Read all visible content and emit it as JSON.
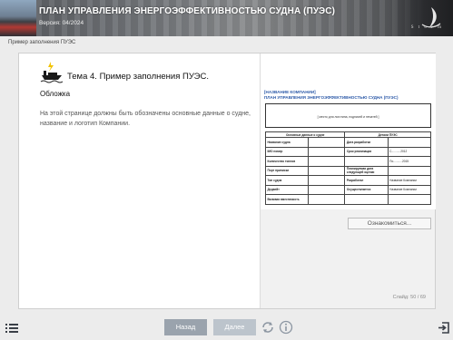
{
  "header": {
    "title": "ПЛАН УПРАВЛЕНИЯ ЭНЕРГОЭФФЕКТИВНОСТЬЮ СУДНА (ПУЭС)",
    "version": "Версия: 04/2024",
    "logo_text": "S t o r m",
    "logo_icon": "sail-logo-icon"
  },
  "breadcrumb": "Пример заполнения ПУЭС",
  "content": {
    "topic_icon": "ship-icon",
    "topic_title": "Тема 4. Пример заполнения ПУЭС.",
    "subtitle": "Обложка",
    "description": "На этой странице должны быть обозначены основные данные о судне, название и логотип Компании."
  },
  "document": {
    "company": "[НАЗВАНИЕ КОМПАНИИ]",
    "plan_title": "ПЛАН УПРАВЛЕНИЯ ЭНЕРГОЭФФЕКТИВНОСТЬЮ СУДНА (ПУЭС)",
    "placeholder": "[ место для логотипа, подписей и печатей ]",
    "table_head_left": "Основные данные о судне",
    "table_head_right": "Детали ПУЭС",
    "rows": [
      {
        "l": "Название судна",
        "lv": "",
        "r": "Дата разработки",
        "rv": ""
      },
      {
        "l": "IMO номер",
        "lv": "",
        "r": "Срок реализации",
        "rv": "С...........2012"
      },
      {
        "l": "Количество тоннов",
        "lv": "",
        "r": "",
        "rv": "По...........2015"
      },
      {
        "l": "Порт приписки",
        "lv": "",
        "r": "Планируемая дата следующей оценки",
        "rv": ""
      },
      {
        "l": "Тип судна",
        "lv": "",
        "r": "Разработал",
        "rv": "Название Компании"
      },
      {
        "l": "Дедвейт",
        "lv": "",
        "r": "Осуществляется",
        "rv": "Название Компании"
      },
      {
        "l": "Валовая вместимость",
        "lv": "",
        "r": "",
        "rv": ""
      }
    ]
  },
  "buttons": {
    "view": "Ознакомиться...",
    "back": "Назад",
    "next": "Далее"
  },
  "slide_label": "Слайд: 50 / 69",
  "icons": {
    "menu": "menu-list-icon",
    "replay": "replay-icon",
    "info": "info-icon",
    "exit": "exit-icon"
  },
  "colors": {
    "accent_blue": "#2d5aa8",
    "button_back": "#9aa3ad",
    "button_next": "#bcc4cc"
  }
}
